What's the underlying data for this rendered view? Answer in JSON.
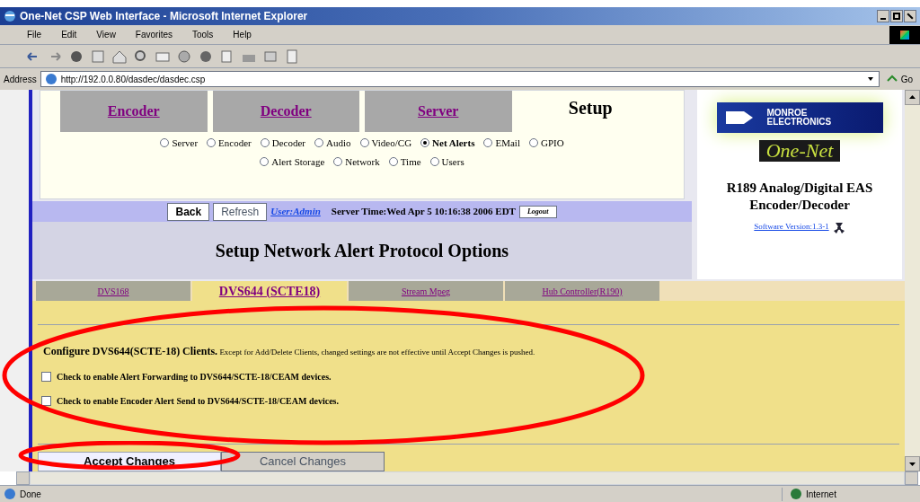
{
  "window": {
    "title": "One-Net CSP Web Interface - Microsoft Internet Explorer"
  },
  "menu": [
    "File",
    "Edit",
    "View",
    "Favorites",
    "Tools",
    "Help"
  ],
  "address": {
    "label": "Address",
    "value": "http://192.0.0.80/dasdec/dasdec.csp",
    "go": "Go"
  },
  "top_tabs": [
    {
      "label": "Encoder",
      "selected": false
    },
    {
      "label": "Decoder",
      "selected": false
    },
    {
      "label": "Server",
      "selected": false
    },
    {
      "label": "Setup",
      "selected": true
    }
  ],
  "setup_options": [
    [
      {
        "label": "Server",
        "selected": false
      },
      {
        "label": "Encoder",
        "selected": false
      },
      {
        "label": "Decoder",
        "selected": false
      },
      {
        "label": "Audio",
        "selected": false
      },
      {
        "label": "Video/CG",
        "selected": false
      },
      {
        "label": "Net Alerts",
        "selected": true
      },
      {
        "label": "EMail",
        "selected": false
      },
      {
        "label": "GPIO",
        "selected": false
      }
    ],
    [
      {
        "label": "Alert Storage",
        "selected": false
      },
      {
        "label": "Network",
        "selected": false
      },
      {
        "label": "Time",
        "selected": false
      },
      {
        "label": "Users",
        "selected": false
      }
    ]
  ],
  "session_bar": {
    "back": "Back",
    "refresh": "Refresh",
    "user": "User:Admin",
    "server_time": "Server Time:Wed Apr 5 10:16:38 2006 EDT",
    "logout": "Logout"
  },
  "page_heading": "Setup Network Alert Protocol Options",
  "brand_panel": {
    "logo_text": "MONROE ELECTRONICS",
    "product_logo": "One-Net",
    "product": "R189 Analog/Digital EAS Encoder/Decoder",
    "version_link": "Software Version:1.3-1"
  },
  "device_tabs": [
    {
      "label": "DVS168",
      "selected": false
    },
    {
      "label": "DVS644 (SCTE18)",
      "selected": true
    },
    {
      "label": "Stream Mpeg",
      "selected": false
    },
    {
      "label": "Hub Controller(R190)",
      "selected": false
    }
  ],
  "config_note": "**Configure DVS644(SCTE-18) Clients.** Except for Add/Delete Clients, changed settings are not effective until Accept Changes is pushed.",
  "options": [
    {
      "label": "Check to enable Alert Forwarding to DVS644/SCTE-18/CEAM devices.",
      "checked": false
    },
    {
      "label": "Check to enable Encoder Alert Send to DVS644/SCTE-18/CEAM devices.",
      "checked": false
    }
  ],
  "actions": [
    {
      "label": "Accept Changes",
      "selected": true
    },
    {
      "label": "Cancel Changes",
      "selected": false
    }
  ],
  "status_bar": {
    "text": "Done",
    "zone": "Internet"
  }
}
